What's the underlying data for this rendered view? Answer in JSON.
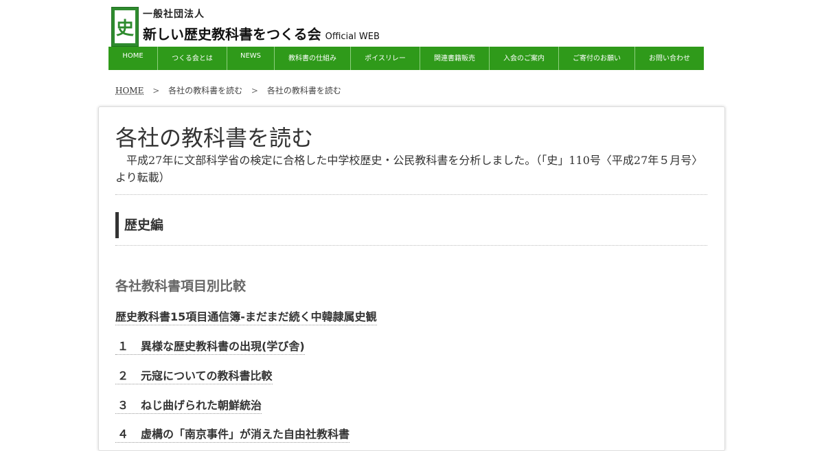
{
  "header": {
    "logo_glyph": "史",
    "org_top": "一般社団法人",
    "org_name": "新しい歴史教科書をつくる会",
    "org_sub": "Official WEB"
  },
  "nav": {
    "items": [
      {
        "label": "HOME"
      },
      {
        "label": "つくる会とは"
      },
      {
        "label": "NEWS"
      },
      {
        "label": "教科書の仕組み"
      },
      {
        "label": "ポイスリレー"
      },
      {
        "label": "関連書籍販売"
      },
      {
        "label": "入会のご案内"
      },
      {
        "label": "ご寄付のお願い"
      },
      {
        "label": "お問い合わせ"
      }
    ]
  },
  "breadcrumb": {
    "home": "HOME",
    "sep": ">",
    "parent": "各社の教科書を読む",
    "current": "各社の教科書を読む"
  },
  "main": {
    "title": "各社の教科書を読む",
    "lead": "平成27年に文部科学省の検定に合格した中学校歴史・公民教科書を分析しました。（「史」110号〈平成27年５月号〉より転載）",
    "section_heading": "歴史編",
    "subheading": "各社教科書項目別比較",
    "links": [
      {
        "num": "",
        "text": "歴史教科書15項目通信簿-まだまだ続く中韓隷属史観"
      },
      {
        "num": "１",
        "text": "異様な歴史教科書の出現(学び舎)"
      },
      {
        "num": "２",
        "text": "元寇についての教科書比較"
      },
      {
        "num": "３",
        "text": "ねじ曲げられた朝鮮統治"
      },
      {
        "num": "４",
        "text": "虚構の「南京事件」が消えた自由社教科書"
      }
    ]
  },
  "colors": {
    "nav_green": "#2f9a1a",
    "logo_green": "#2e8b2e"
  }
}
